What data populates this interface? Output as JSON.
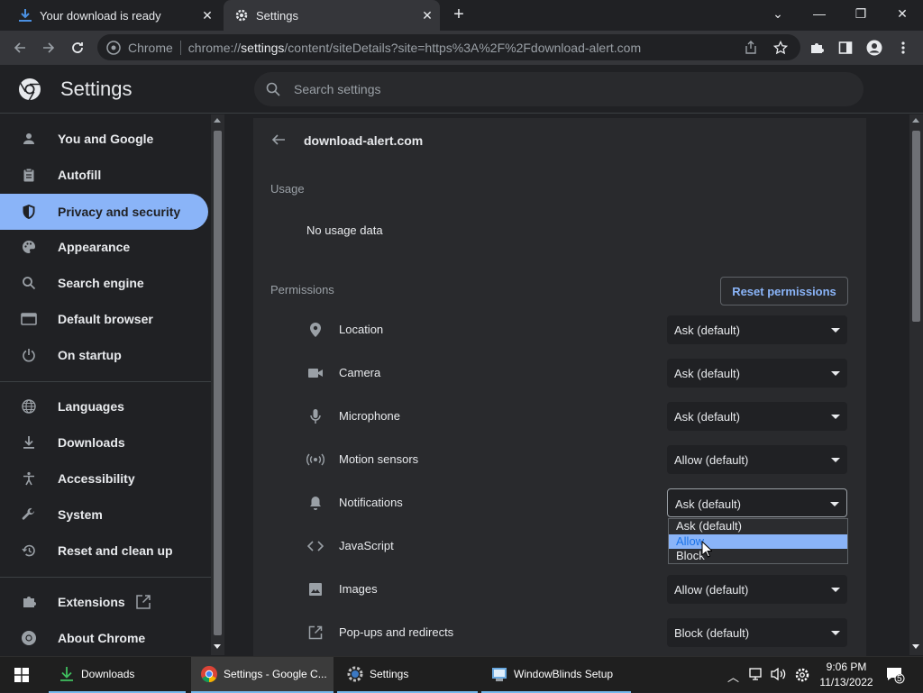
{
  "tabs": [
    {
      "title": "Your download is ready",
      "icon": "download-icon"
    },
    {
      "title": "Settings",
      "icon": "gear-icon"
    }
  ],
  "omnibox": {
    "chip": "Chrome",
    "url_prefix": "chrome://",
    "url_host": "settings",
    "url_rest": "/content/siteDetails?site=https%3A%2F%2Fdownload-alert.com"
  },
  "header": {
    "title": "Settings",
    "search_placeholder": "Search settings"
  },
  "sidebar": {
    "items": [
      {
        "label": "You and Google",
        "icon": "person-icon"
      },
      {
        "label": "Autofill",
        "icon": "clipboard-icon"
      },
      {
        "label": "Privacy and security",
        "icon": "shield-icon"
      },
      {
        "label": "Appearance",
        "icon": "palette-icon"
      },
      {
        "label": "Search engine",
        "icon": "search-icon"
      },
      {
        "label": "Default browser",
        "icon": "browser-icon"
      },
      {
        "label": "On startup",
        "icon": "power-icon"
      },
      {
        "label": "Languages",
        "icon": "globe-icon"
      },
      {
        "label": "Downloads",
        "icon": "download-icon"
      },
      {
        "label": "Accessibility",
        "icon": "accessibility-icon"
      },
      {
        "label": "System",
        "icon": "wrench-icon"
      },
      {
        "label": "Reset and clean up",
        "icon": "history-icon"
      },
      {
        "label": "Extensions",
        "icon": "puzzle-icon"
      },
      {
        "label": "About Chrome",
        "icon": "chrome-icon"
      }
    ],
    "active": "Privacy and security"
  },
  "site": {
    "name": "download-alert.com",
    "usage_heading": "Usage",
    "usage_value": "No usage data",
    "permissions_heading": "Permissions",
    "reset_label": "Reset permissions"
  },
  "permissions": [
    {
      "label": "Location",
      "value": "Ask (default)",
      "icon": "location-pin-icon"
    },
    {
      "label": "Camera",
      "value": "Ask (default)",
      "icon": "camera-icon"
    },
    {
      "label": "Microphone",
      "value": "Ask (default)",
      "icon": "microphone-icon"
    },
    {
      "label": "Motion sensors",
      "value": "Allow (default)",
      "icon": "sensors-icon"
    },
    {
      "label": "Notifications",
      "value": "Ask (default)",
      "icon": "bell-icon"
    },
    {
      "label": "JavaScript",
      "value": "",
      "icon": "code-icon"
    },
    {
      "label": "Images",
      "value": "Allow (default)",
      "icon": "image-icon"
    },
    {
      "label": "Pop-ups and redirects",
      "value": "Block (default)",
      "icon": "open-in-new-icon"
    }
  ],
  "dropdown_options": [
    "Ask (default)",
    "Allow",
    "Block"
  ],
  "dropdown_highlighted": "Allow",
  "taskbar": {
    "items": [
      "Downloads",
      "Settings - Google C...",
      "Settings",
      "WindowBlinds Setup"
    ],
    "time": "9:06 PM",
    "date": "11/13/2022",
    "notification_count": "5"
  },
  "colors": {
    "accent": "#8ab4f8",
    "background": "#202124",
    "panel": "#292a2d"
  }
}
